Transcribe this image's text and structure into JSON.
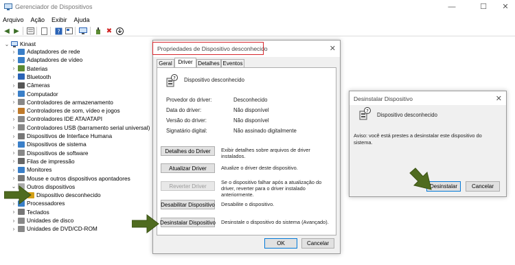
{
  "window": {
    "title": "Gerenciador de Dispositivos",
    "min": "—",
    "max": "☐",
    "close": "✕"
  },
  "menu": [
    "Arquivo",
    "Ação",
    "Exibir",
    "Ajuda"
  ],
  "tree": {
    "root": "Kinast",
    "items": [
      "Adaptadores de rede",
      "Adaptadores de vídeo",
      "Baterias",
      "Bluetooth",
      "Câmeras",
      "Computador",
      "Controladores de armazenamento",
      "Controladores de som, vídeo e jogos",
      "Controladores IDE ATA/ATAPI",
      "Controladores USB (barramento serial universal)",
      "Dispositivos de Interface Humana",
      "Dispositivos de sistema",
      "Dispositivos de software",
      "Filas de impressão",
      "Monitores",
      "Mouse e outros dispositivos apontadores",
      "Outros dispositivos",
      "Dispositivo desconhecido",
      "Processadores",
      "Teclados",
      "Unidades de disco",
      "Unidades de DVD/CD-ROM"
    ]
  },
  "properties": {
    "title": "Propriedades de Dispositivo desconhecido",
    "tabs": [
      "Geral",
      "Driver",
      "Detalhes",
      "Eventos"
    ],
    "device_name": "Dispositivo desconhecido",
    "fields": [
      {
        "label": "Provedor do driver:",
        "value": "Desconhecido"
      },
      {
        "label": "Data do driver:",
        "value": "Não disponível"
      },
      {
        "label": "Versão do driver:",
        "value": "Não disponível"
      },
      {
        "label": "Signatário digital:",
        "value": "Não assinado digitalmente"
      }
    ],
    "actions": [
      {
        "label": "Detalhes do Driver",
        "desc": "Exibir detalhes sobre arquivos de driver instalados."
      },
      {
        "label": "Atualizar Driver",
        "desc": "Atualize o driver deste dispositivo."
      },
      {
        "label": "Reverter Driver",
        "desc": "Se o dispositivo falhar após a atualização do driver, reverter para o driver instalado anteriormente."
      },
      {
        "label": "Desabilitar Dispositivo",
        "desc": "Desabilite o dispositivo."
      },
      {
        "label": "Desinstalar Dispositivo",
        "desc": "Desinstale o dispositivo do sistema (Avançado)."
      }
    ],
    "ok": "OK",
    "cancel": "Cancelar"
  },
  "uninstall": {
    "title": "Desinstalar Dispositivo",
    "device_name": "Dispositivo desconhecido",
    "warning": "Aviso: você está prestes a desinstalar este dispositivo do sistema.",
    "confirm": "Desinstalar",
    "cancel": "Cancelar"
  },
  "colors": {
    "accent": "#0078d7",
    "highlight_box": "#d6242a",
    "arrow": "#4f6b1f"
  }
}
